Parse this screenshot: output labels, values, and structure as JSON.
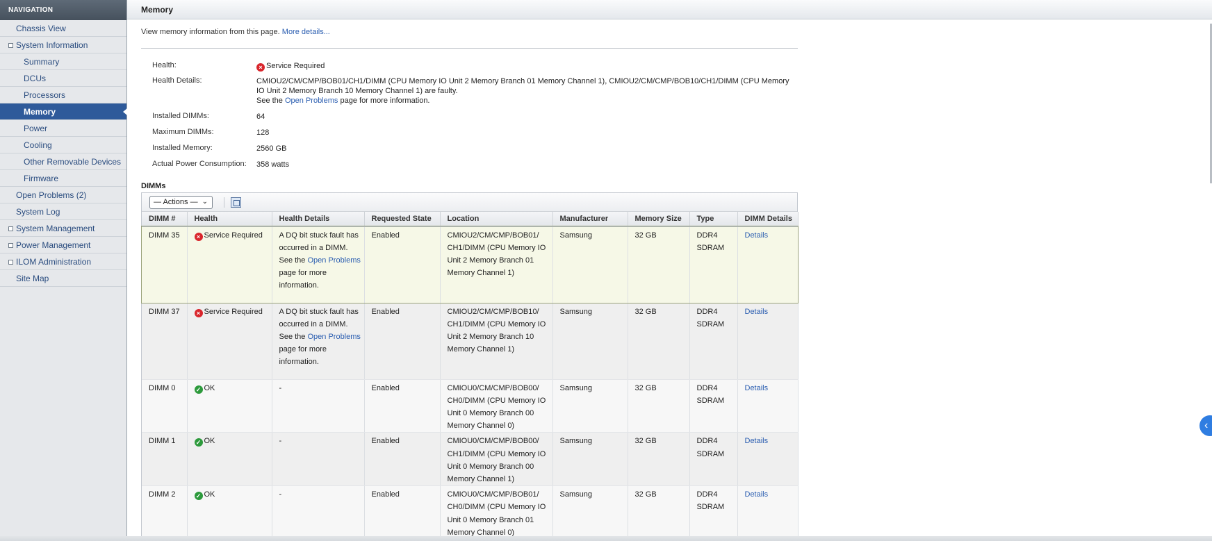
{
  "nav": {
    "header": "NAVIGATION",
    "items": [
      {
        "label": "Chassis View"
      },
      {
        "label": "System Information"
      },
      {
        "label": "Summary"
      },
      {
        "label": "DCUs"
      },
      {
        "label": "Processors"
      },
      {
        "label": "Memory"
      },
      {
        "label": "Power"
      },
      {
        "label": "Cooling"
      },
      {
        "label": "Other Removable Devices"
      },
      {
        "label": "Firmware"
      },
      {
        "label": "Open Problems (2)"
      },
      {
        "label": "System Log"
      },
      {
        "label": "System Management"
      },
      {
        "label": "Power Management"
      },
      {
        "label": "ILOM Administration"
      },
      {
        "label": "Site Map"
      }
    ]
  },
  "page": {
    "title": "Memory",
    "description": "View memory information from this page.",
    "more_details": "More details..."
  },
  "summary": {
    "health_label": "Health:",
    "health_value": "Service Required",
    "health_details_label": "Health Details:",
    "health_details_text": "CMIOU2/CM/CMP/BOB01/CH1/DIMM (CPU Memory IO Unit 2 Memory Branch 01 Memory Channel 1), CMIOU2/CM/CMP/BOB10/CH1/DIMM (CPU Memory IO Unit 2 Memory Branch 10 Memory Channel 1) are faulty.",
    "see_the": "See the",
    "open_problems_link": "Open Problems",
    "more_info": "page for more information.",
    "installed_dimms_label": "Installed DIMMs:",
    "installed_dimms_value": "64",
    "maximum_dimms_label": "Maximum DIMMs:",
    "maximum_dimms_value": "128",
    "installed_memory_label": "Installed Memory:",
    "installed_memory_value": "2560 GB",
    "power_label": "Actual Power Consumption:",
    "power_value": "358 watts"
  },
  "dimms": {
    "section_title": "DIMMs",
    "actions_label": "— Actions —",
    "columns": [
      "DIMM #",
      "Health",
      "Health Details",
      "Requested State",
      "Location",
      "Manufacturer",
      "Memory Size",
      "Type",
      "DIMM Details"
    ],
    "rows": [
      {
        "dimm": "DIMM 35",
        "health": "Service Required",
        "hd_line1": "A DQ bit stuck fault has occurred in a DIMM.",
        "hd_see": "See the",
        "hd_link": "Open Problems",
        "hd_tail": "page for more information.",
        "state": "Enabled",
        "location": "CMIOU2/CM/CMP/BOB01/ CH1/DIMM (CPU Memory IO Unit 2 Memory Branch 01 Memory Channel 1)",
        "manufacturer": "Samsung",
        "size": "32 GB",
        "type": "DDR4 SDRAM",
        "details": "Details"
      },
      {
        "dimm": "DIMM 37",
        "health": "Service Required",
        "hd_line1": "A DQ bit stuck fault has occurred in a DIMM.",
        "hd_see": "See the",
        "hd_link": "Open Problems",
        "hd_tail": "page for more information.",
        "state": "Enabled",
        "location": "CMIOU2/CM/CMP/BOB10/ CH1/DIMM (CPU Memory IO Unit 2 Memory Branch 10 Memory Channel 1)",
        "manufacturer": "Samsung",
        "size": "32 GB",
        "type": "DDR4 SDRAM",
        "details": "Details"
      },
      {
        "dimm": "DIMM 0",
        "health": "OK",
        "hd_line1": "-",
        "state": "Enabled",
        "location": "CMIOU0/CM/CMP/BOB00/ CH0/DIMM (CPU Memory IO Unit 0 Memory Branch 00 Memory Channel 0)",
        "manufacturer": "Samsung",
        "size": "32 GB",
        "type": "DDR4 SDRAM",
        "details": "Details"
      },
      {
        "dimm": "DIMM 1",
        "health": "OK",
        "hd_line1": "-",
        "state": "Enabled",
        "location": "CMIOU0/CM/CMP/BOB00/ CH1/DIMM (CPU Memory IO Unit 0 Memory Branch 00 Memory Channel 1)",
        "manufacturer": "Samsung",
        "size": "32 GB",
        "type": "DDR4 SDRAM",
        "details": "Details"
      },
      {
        "dimm": "DIMM 2",
        "health": "OK",
        "hd_line1": "-",
        "state": "Enabled",
        "location": "CMIOU0/CM/CMP/BOB01/ CH0/DIMM (CPU Memory IO Unit 0 Memory Branch 01 Memory Channel 0)",
        "manufacturer": "Samsung",
        "size": "32 GB",
        "type": "DDR4 SDRAM",
        "details": "Details"
      }
    ]
  },
  "colors": {
    "accent": "#2e5a9a",
    "link": "#2a5db0",
    "error": "#d9262c",
    "ok": "#2d9a3c"
  }
}
